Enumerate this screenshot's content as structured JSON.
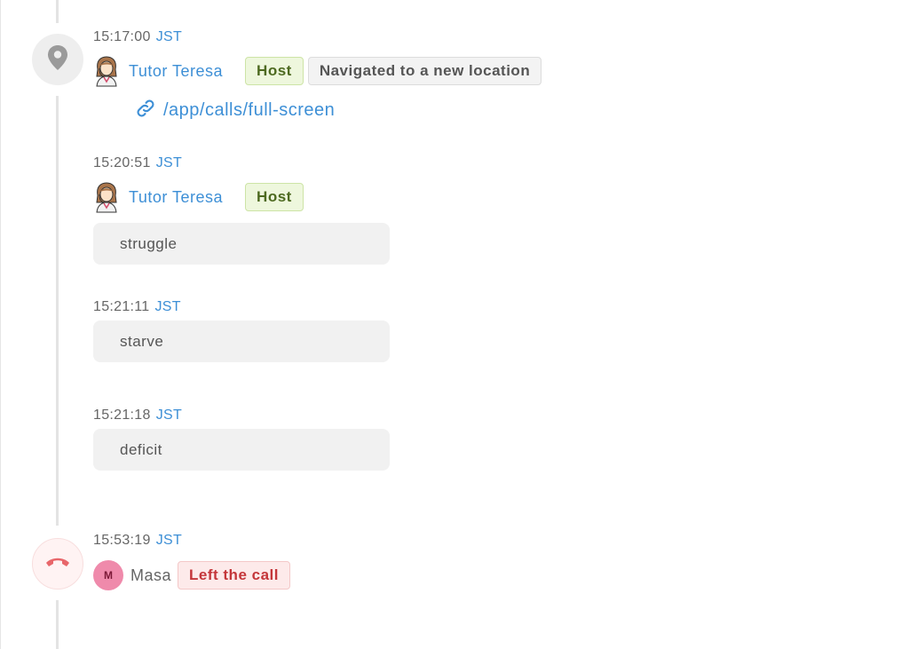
{
  "events": [
    {
      "time": "15:17:00",
      "tz": "JST",
      "user": "Tutor Teresa",
      "role_badge": "Host",
      "action_badge": "Navigated to a new location",
      "link": "/app/calls/full-screen",
      "icon": "location-pin-icon"
    },
    {
      "time": "15:20:51",
      "tz": "JST",
      "user": "Tutor Teresa",
      "role_badge": "Host",
      "message": "struggle"
    },
    {
      "time": "15:21:11",
      "tz": "JST",
      "message": "starve"
    },
    {
      "time": "15:21:18",
      "tz": "JST",
      "message": "deficit"
    },
    {
      "time": "15:53:19",
      "tz": "JST",
      "user": "Masa",
      "avatar_initial": "M",
      "action_badge": "Left the call",
      "icon": "hang-up-phone-icon"
    }
  ],
  "colors": {
    "link": "#3d8fd6",
    "host_badge_bg": "#eef7dd",
    "left_badge_text": "#c4363a",
    "hangup_icon": "#e8666a"
  }
}
